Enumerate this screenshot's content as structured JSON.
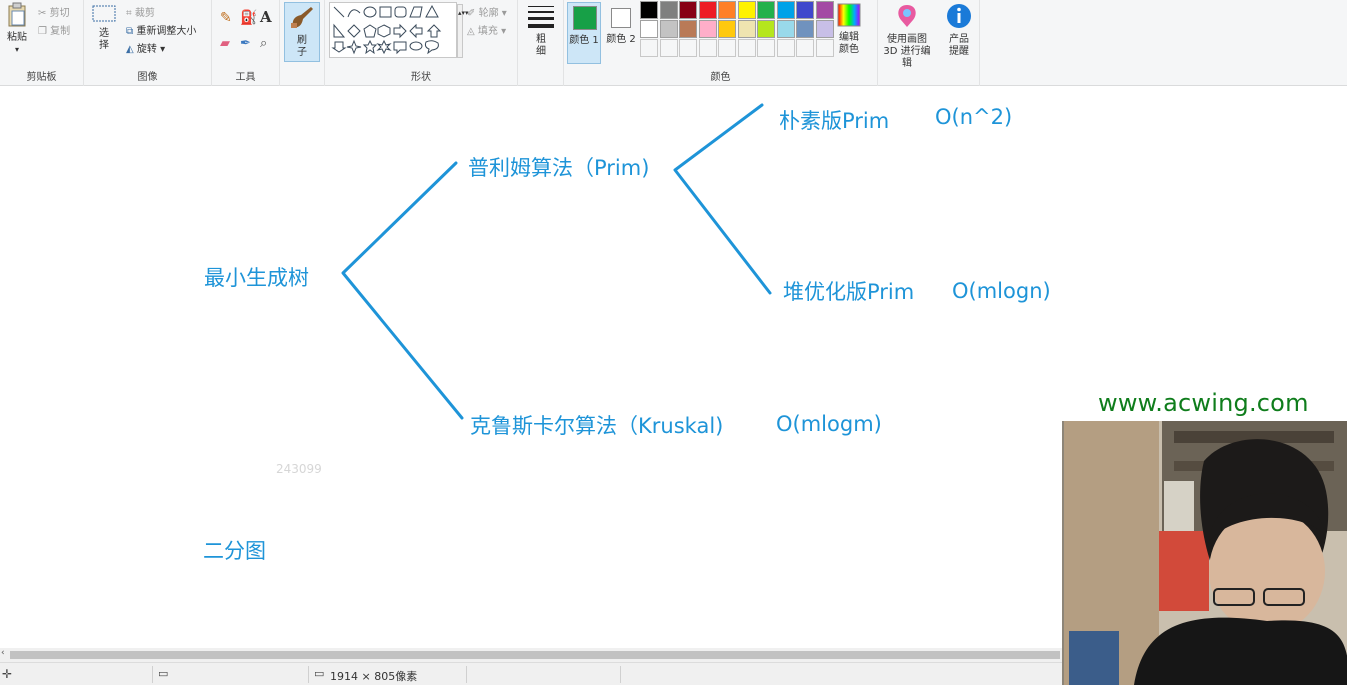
{
  "ribbon": {
    "clipboard": {
      "paste": "粘贴",
      "cut": "剪切",
      "copy": "复制",
      "label": "剪贴板"
    },
    "image": {
      "select": "选择",
      "crop": "裁剪",
      "resize": "重新调整大小",
      "rotate": "旋转",
      "label": "图像"
    },
    "tools": {
      "label": "工具"
    },
    "brush": {
      "label": "刷子"
    },
    "shapes": {
      "outline": "轮廓",
      "fill": "填充",
      "label": "形状"
    },
    "size": {
      "label": "粗细"
    },
    "colors": {
      "color1": "颜色 1",
      "color2": "颜色 2",
      "edit": "编辑颜色",
      "label": "颜色",
      "color1_value": "#17a047",
      "color2_value": "#ffffff",
      "palette_row1": [
        "#000000",
        "#7f7f7f",
        "#880015",
        "#ed1c24",
        "#ff7f27",
        "#fff200",
        "#22b14c",
        "#00a2e8",
        "#3f48cc",
        "#a349a4"
      ],
      "palette_row2": [
        "#ffffff",
        "#c3c3c3",
        "#b97a57",
        "#ffaec9",
        "#ffc90e",
        "#efe4b0",
        "#b5e61d",
        "#99d9ea",
        "#7092be",
        "#c8bfe7"
      ]
    },
    "paint3d": {
      "label": "使用画图 3D 进行编辑"
    },
    "product": {
      "label": "产品提醒"
    }
  },
  "canvas": {
    "root": "最小生成树",
    "prim": "普利姆算法（Prim)",
    "prim_naive": "朴素版Prim",
    "prim_naive_complexity": "O(n^2)",
    "prim_heap": "堆优化版Prim",
    "prim_heap_complexity": "O(mlogn)",
    "kruskal": "克鲁斯卡尔算法（Kruskal)",
    "kruskal_complexity": "O(mlogm)",
    "bipartite": "二分图",
    "watermark_number": "243099",
    "line_color": "#1e94d8"
  },
  "overlay": {
    "brand": "www.acwing.com"
  },
  "status": {
    "dimensions": "1914 × 805像素"
  }
}
